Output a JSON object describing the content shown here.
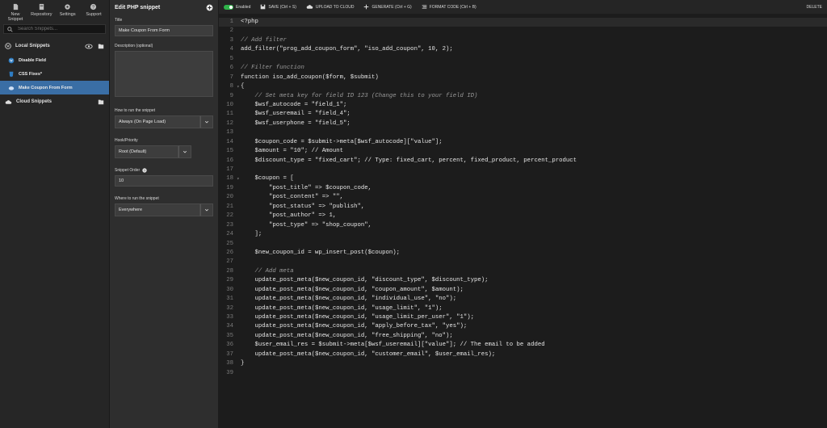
{
  "sidebar": {
    "top_icons": [
      {
        "label": "New Snippet",
        "icon": "file-icon"
      },
      {
        "label": "Repository",
        "icon": "box-icon"
      },
      {
        "label": "Settings",
        "icon": "gear-icon"
      },
      {
        "label": "Support",
        "icon": "help-icon"
      }
    ],
    "search_placeholder": "Search Snippets...",
    "local_header": "Local Snippets",
    "items": [
      {
        "label": "Disable Field",
        "icon": "wordpress-icon"
      },
      {
        "label": "CSS Fixes*",
        "icon": "css-icon"
      },
      {
        "label": "Make Coupon From Form",
        "icon": "elephant-icon",
        "active": true
      }
    ],
    "cloud_header": "Cloud Snippets"
  },
  "panel": {
    "title": "Edit PHP snippet",
    "title_label": "Title",
    "title_value": "Make Coupon From Form",
    "description_label": "Description (optional)",
    "how_label": "How to run the snippet",
    "how_value": "Always (On Page Load)",
    "hook_label": "Hook/Priority",
    "hook_value": "Root (Default)",
    "order_label": "Snippet Order",
    "order_value": "10",
    "where_label": "Where to run the snippet",
    "where_value": "Everywhere"
  },
  "toolbar": {
    "enabled": "Enabled",
    "save": "SAVE (Ctrl + S)",
    "upload": "UPLOAD TO CLOUD",
    "generate": "GENERATE (Ctrl + G)",
    "format": "FORMAT CODE (Ctrl + B)",
    "delete": "DELETE"
  },
  "code_lines": [
    "<?php",
    "",
    "// Add filter",
    "add_filter(\"prog_add_coupon_form\", \"iso_add_coupon\", 10, 2);",
    "",
    "// Filter function",
    "function iso_add_coupon($form, $submit)",
    "{",
    "    // Set meta key for field ID 123 (Change this to your field ID)",
    "    $wsf_autocode = \"field_1\";",
    "    $wsf_useremail = \"field_4\";",
    "    $wsf_userphone = \"field_5\";",
    "",
    "    $coupon_code = $submit->meta[$wsf_autocode][\"value\"];",
    "    $amount = \"10\"; // Amount",
    "    $discount_type = \"fixed_cart\"; // Type: fixed_cart, percent, fixed_product, percent_product",
    "",
    "    $coupon = [",
    "        \"post_title\" => $coupon_code,",
    "        \"post_content\" => \"\",",
    "        \"post_status\" => \"publish\",",
    "        \"post_author\" => 1,",
    "        \"post_type\" => \"shop_coupon\",",
    "    ];",
    "",
    "    $new_coupon_id = wp_insert_post($coupon);",
    "",
    "    // Add meta",
    "    update_post_meta($new_coupon_id, \"discount_type\", $discount_type);",
    "    update_post_meta($new_coupon_id, \"coupon_amount\", $amount);",
    "    update_post_meta($new_coupon_id, \"individual_use\", \"no\");",
    "    update_post_meta($new_coupon_id, \"usage_limit\", \"1\");",
    "    update_post_meta($new_coupon_id, \"usage_limit_per_user\", \"1\");",
    "    update_post_meta($new_coupon_id, \"apply_before_tax\", \"yes\");",
    "    update_post_meta($new_coupon_id, \"free_shipping\", \"no\");",
    "    $user_email_res = $submit->meta[$wsf_useremail][\"value\"]; // The email to be added",
    "    update_post_meta($new_coupon_id, \"customer_email\", $user_email_res);",
    "}",
    ""
  ]
}
